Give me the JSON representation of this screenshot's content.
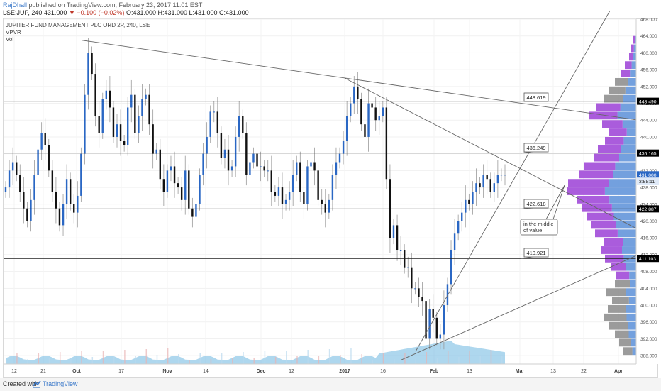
{
  "header": {
    "user": "RajDhall",
    "published_text": "published on TradingView.com, February 23, 2017 11:01 EST",
    "symbol_line": "LSE:JUP, 240",
    "open_label": "431.000",
    "change_text": "▼ −0.100 (−0.02%)",
    "ohlc_text": "O:431.000 H:431.000 L:431.000 C:431.000"
  },
  "legend": {
    "title": "JUPITER FUND MANAGEMENT PLC ORD 2P, 240, LSE",
    "indicator1": "VPVR",
    "indicator2": "Vol"
  },
  "footer": {
    "created_with": "Created with",
    "brand": "TradingView"
  },
  "colors": {
    "up": "#2a67c4",
    "down": "#111111",
    "vol": "#6cb6e0",
    "vp_up": "#5b8fd8",
    "vp_down": "#9b3fd6",
    "vp_gray": "#8a8a8a",
    "line": "#666666"
  },
  "chart_data": {
    "type": "candlestick",
    "title": "JUPITER FUND MANAGEMENT PLC ORD 2P, 240, LSE",
    "ylim": [
      386,
      468
    ],
    "y_ticks": [
      388,
      392,
      396,
      400,
      404,
      408,
      412,
      416,
      420,
      424,
      428,
      432,
      436,
      440,
      444,
      448,
      452,
      456,
      460,
      464,
      468
    ],
    "x_ticks": [
      "12",
      "21",
      "Oct",
      "17",
      "Nov",
      "14",
      "Dec",
      "12",
      "2017",
      "16",
      "Feb",
      "13",
      "Mar",
      "13",
      "22",
      "Apr"
    ],
    "price_labels": [
      {
        "value": 448.49,
        "text": "448.490"
      },
      {
        "value": 436.165,
        "text": "436.165"
      },
      {
        "value": 431.0,
        "text": "431.000"
      },
      {
        "value": 429.5,
        "text": "3:58:11"
      },
      {
        "value": 422.887,
        "text": "422.887"
      },
      {
        "value": 411.103,
        "text": "411.103"
      }
    ],
    "horizontal_levels": [
      448.49,
      436.165,
      422.887,
      411.103
    ],
    "callouts": [
      "448.619",
      "436.249",
      "422.618",
      "410.921"
    ],
    "annotation": "in the middle of value",
    "current_price": 431.0,
    "series": [
      {
        "name": "price",
        "closes": [
          428,
          432,
          434,
          431,
          427,
          423,
          420,
          425,
          431,
          437,
          441,
          438,
          432,
          427,
          423,
          419,
          424,
          430,
          424,
          422,
          426,
          436,
          450,
          460,
          455,
          445,
          441,
          449,
          451,
          447,
          440,
          443,
          439,
          438,
          447,
          450,
          441,
          445,
          449,
          450,
          443,
          436,
          437,
          430,
          427,
          432,
          433,
          429,
          428,
          425,
          432,
          423,
          421,
          424,
          431,
          436,
          440,
          446,
          446,
          441,
          435,
          437,
          432,
          433,
          440,
          445,
          441,
          431,
          434,
          436,
          433,
          433,
          432,
          432,
          427,
          426,
          428,
          424,
          425,
          427,
          431,
          434,
          427,
          424,
          433,
          434,
          432,
          425,
          424,
          422,
          425,
          431,
          434,
          436,
          439,
          445,
          448,
          452,
          449,
          443,
          440,
          448,
          447,
          444,
          445,
          447,
          430,
          416,
          419,
          413,
          413,
          409,
          409,
          404,
          404,
          402,
          401,
          392,
          399,
          397,
          392,
          393,
          400,
          405,
          413,
          417,
          420,
          422,
          425,
          424,
          427,
          429,
          428,
          431,
          430,
          427,
          429,
          431,
          431,
          431
        ]
      }
    ]
  }
}
